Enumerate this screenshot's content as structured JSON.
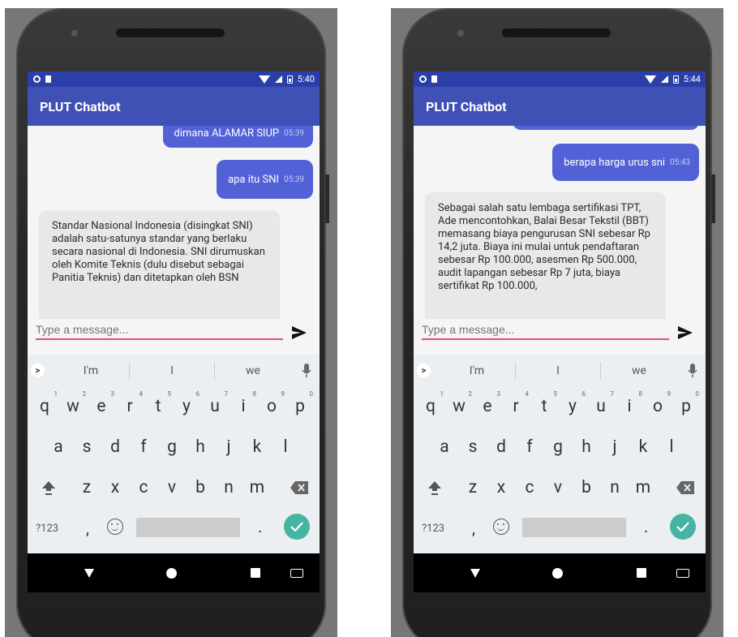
{
  "screens": [
    {
      "status_time": "5:40",
      "app_title": "PLUT Chatbot",
      "messages": [
        {
          "from": "user",
          "text": "dimana ALAMAR SIUP",
          "time": "05:39"
        },
        {
          "from": "user",
          "text": "apa itu SNI",
          "time": "05:39"
        },
        {
          "from": "bot",
          "text": "Standar Nasional Indonesia (disingkat SNI) adalah satu-satunya standar yang berlaku secara nasional di Indonesia. SNI dirumuskan oleh Komite Teknis (dulu disebut sebagai Panitia Teknis) dan ditetapkan oleh BSN"
        }
      ],
      "input_placeholder": "Type a message..."
    },
    {
      "status_time": "5:44",
      "app_title": "PLUT Chatbot",
      "messages": [
        {
          "from": "user",
          "text": "berapa harga urus sni",
          "time": "05:43"
        },
        {
          "from": "bot",
          "text": "Sebagai salah satu lembaga sertifikasi TPT, Ade mencontohkan, Balai Besar Tekstil (BBT) memasang biaya pengurusan SNI sebesar Rp 14,2 juta. Biaya ini mulai untuk pendaftaran sebesar Rp 100.000, asesmen Rp 500.000, audit lapangan sebesar Rp 7 juta, biaya sertifikat Rp 100.000,"
        }
      ],
      "input_placeholder": "Type a message..."
    }
  ],
  "keyboard": {
    "suggestions": [
      "I'm",
      "I",
      "we"
    ],
    "row1": [
      "q",
      "w",
      "e",
      "r",
      "t",
      "y",
      "u",
      "i",
      "o",
      "p"
    ],
    "row1_numbers": [
      "1",
      "2",
      "3",
      "4",
      "5",
      "6",
      "7",
      "8",
      "9",
      "0"
    ],
    "row2": [
      "a",
      "s",
      "d",
      "f",
      "g",
      "h",
      "j",
      "k",
      "l"
    ],
    "row3": [
      "z",
      "x",
      "c",
      "v",
      "b",
      "n",
      "m"
    ],
    "symbols_label": "?123",
    "comma": ",",
    "period": "."
  },
  "colors": {
    "status_bar": "#2c3ea8",
    "app_bar": "#3f51b5",
    "user_bubble": "#5262d6",
    "bot_bubble": "#e8e8e8",
    "input_underline": "#e84a79",
    "enter_key": "#46b4a3"
  },
  "icons": [
    "notification-circle-icon",
    "sd-card-icon",
    "wifi-icon",
    "signal-icon",
    "battery-icon",
    "send-icon",
    "chevron-right-icon",
    "mic-icon",
    "shift-icon",
    "backspace-icon",
    "emoji-icon",
    "check-icon",
    "nav-back-icon",
    "nav-home-icon",
    "nav-recent-icon",
    "keyboard-icon"
  ]
}
